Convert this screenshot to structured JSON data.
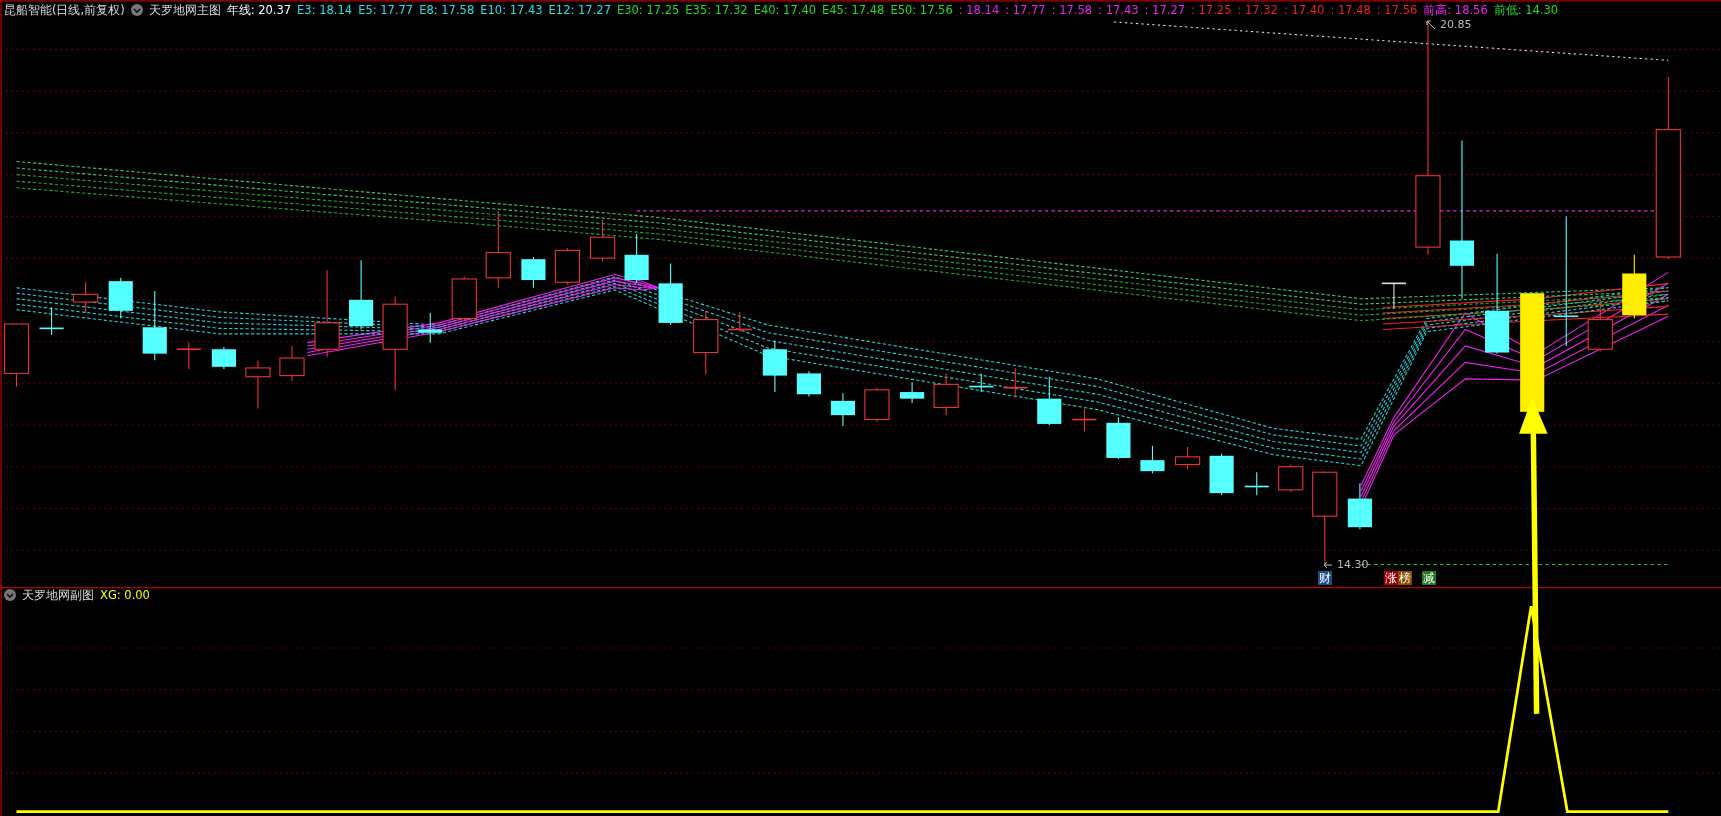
{
  "main_chart": {
    "title": "昆船智能(日线,前复权)",
    "indicator": "天罗地网主图",
    "readouts": [
      {
        "text": "年线: 20.37",
        "color": "#ffffff"
      },
      {
        "text": "E3: 18.14",
        "color": "#22e0e8"
      },
      {
        "text": "E5: 17.77",
        "color": "#22e0e8"
      },
      {
        "text": "E8: 17.58",
        "color": "#22e0e8"
      },
      {
        "text": "E10: 17.43",
        "color": "#22e0e8"
      },
      {
        "text": "E12: 17.27",
        "color": "#22e0e8"
      },
      {
        "text": "E30: 17.25",
        "color": "#22dd22"
      },
      {
        "text": "E35: 17.32",
        "color": "#22dd22"
      },
      {
        "text": "E40: 17.40",
        "color": "#22dd22"
      },
      {
        "text": "E45: 17.48",
        "color": "#22dd22"
      },
      {
        "text": "E50: 17.56",
        "color": "#22dd22"
      },
      {
        "text": ": 18.14",
        "color": "#ee22ee"
      },
      {
        "text": ": 17.77",
        "color": "#ee22ee"
      },
      {
        "text": ": 17.58",
        "color": "#ee22ee"
      },
      {
        "text": ": 17.43",
        "color": "#ee22ee"
      },
      {
        "text": ": 17.27",
        "color": "#ee22ee"
      },
      {
        "text": ": 17.25",
        "color": "#ee2222"
      },
      {
        "text": ": 17.32",
        "color": "#ee2222"
      },
      {
        "text": ": 17.40",
        "color": "#ee2222"
      },
      {
        "text": ": 17.48",
        "color": "#ee2222"
      },
      {
        "text": ": 17.56",
        "color": "#ee2222"
      },
      {
        "text": "前高: 18.56",
        "color": "#ee22ee"
      },
      {
        "text": "前低: 14.30",
        "color": "#22dd22"
      }
    ],
    "high_label": "20.85",
    "low_label": "14.30",
    "tags": [
      {
        "text": "财",
        "color": "#1b4f8a"
      },
      {
        "text": "涨",
        "color": "#990000"
      },
      {
        "text": "榜",
        "color": "#8a4a00"
      },
      {
        "text": "减",
        "color": "#1f7a1f"
      }
    ]
  },
  "sub_chart": {
    "indicator": "天罗地网副图",
    "readouts": [
      {
        "text": "XG: 0.00",
        "color": "#ffff00"
      }
    ]
  }
}
